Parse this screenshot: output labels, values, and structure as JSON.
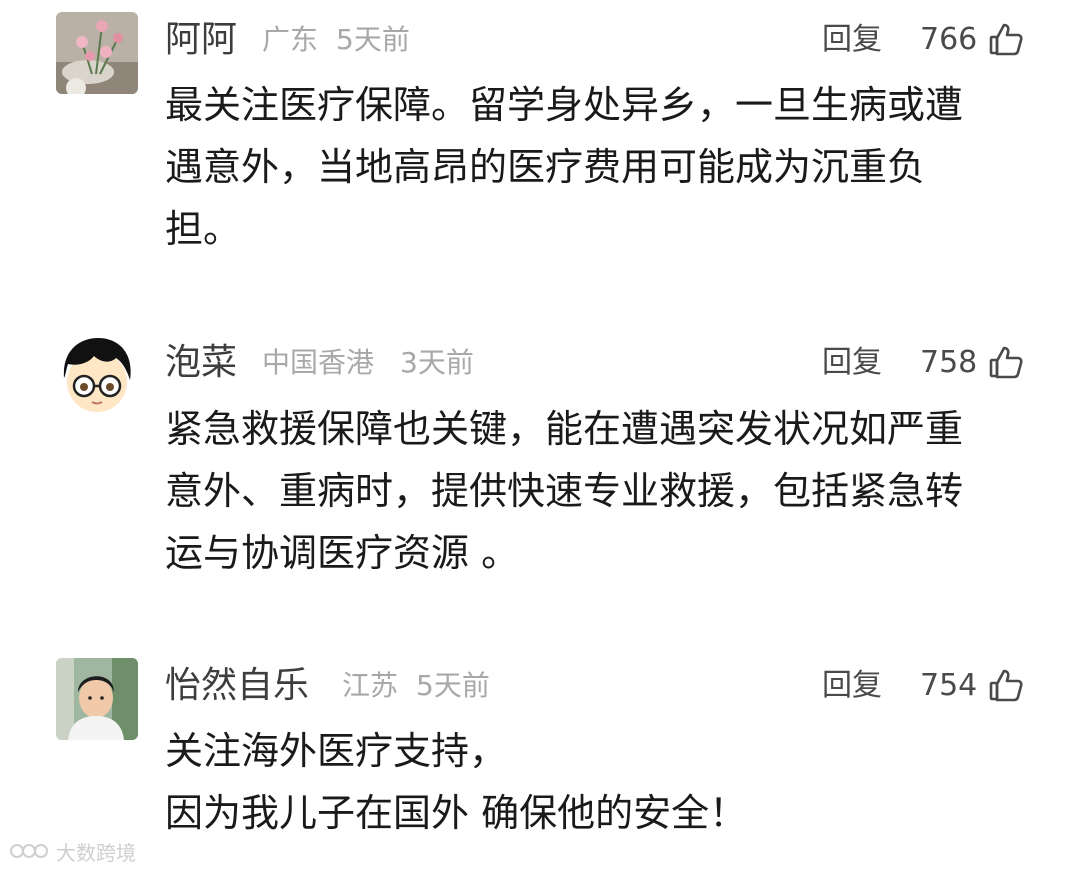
{
  "comments": [
    {
      "username": "阿阿",
      "location": "广东",
      "time": "5天前",
      "reply_label": "回复",
      "likes": "766",
      "lines": [
        "最关注医疗保障。留学身处异乡，一旦生病或遭",
        "遇意外，当地高昂的医疗费用可能成为沉重负",
        "担。"
      ]
    },
    {
      "username": "泡菜",
      "location": "中国香港",
      "time": "3天前",
      "reply_label": "回复",
      "likes": "758",
      "lines": [
        "紧急救援保障也关键，能在遭遇突发状况如严重",
        "意外、重病时，提供快速专业救援，包括紧急转",
        "运与协调医疗资源 。"
      ]
    },
    {
      "username": "怡然自乐",
      "location": "江苏",
      "time": "5天前",
      "reply_label": "回复",
      "likes": "754",
      "lines": [
        "关注海外医疗支持，",
        "因为我儿子在国外 确保他的安全！"
      ]
    }
  ],
  "watermark": {
    "text": "大数跨境"
  },
  "icons": {
    "like": "thumbs-up-icon",
    "watermark_logo": "brand-logo-icon"
  },
  "colors": {
    "text": "#1a1a1a",
    "username": "#3d3d3d",
    "meta": "#a8a8a8",
    "action": "#4a4a4a"
  }
}
